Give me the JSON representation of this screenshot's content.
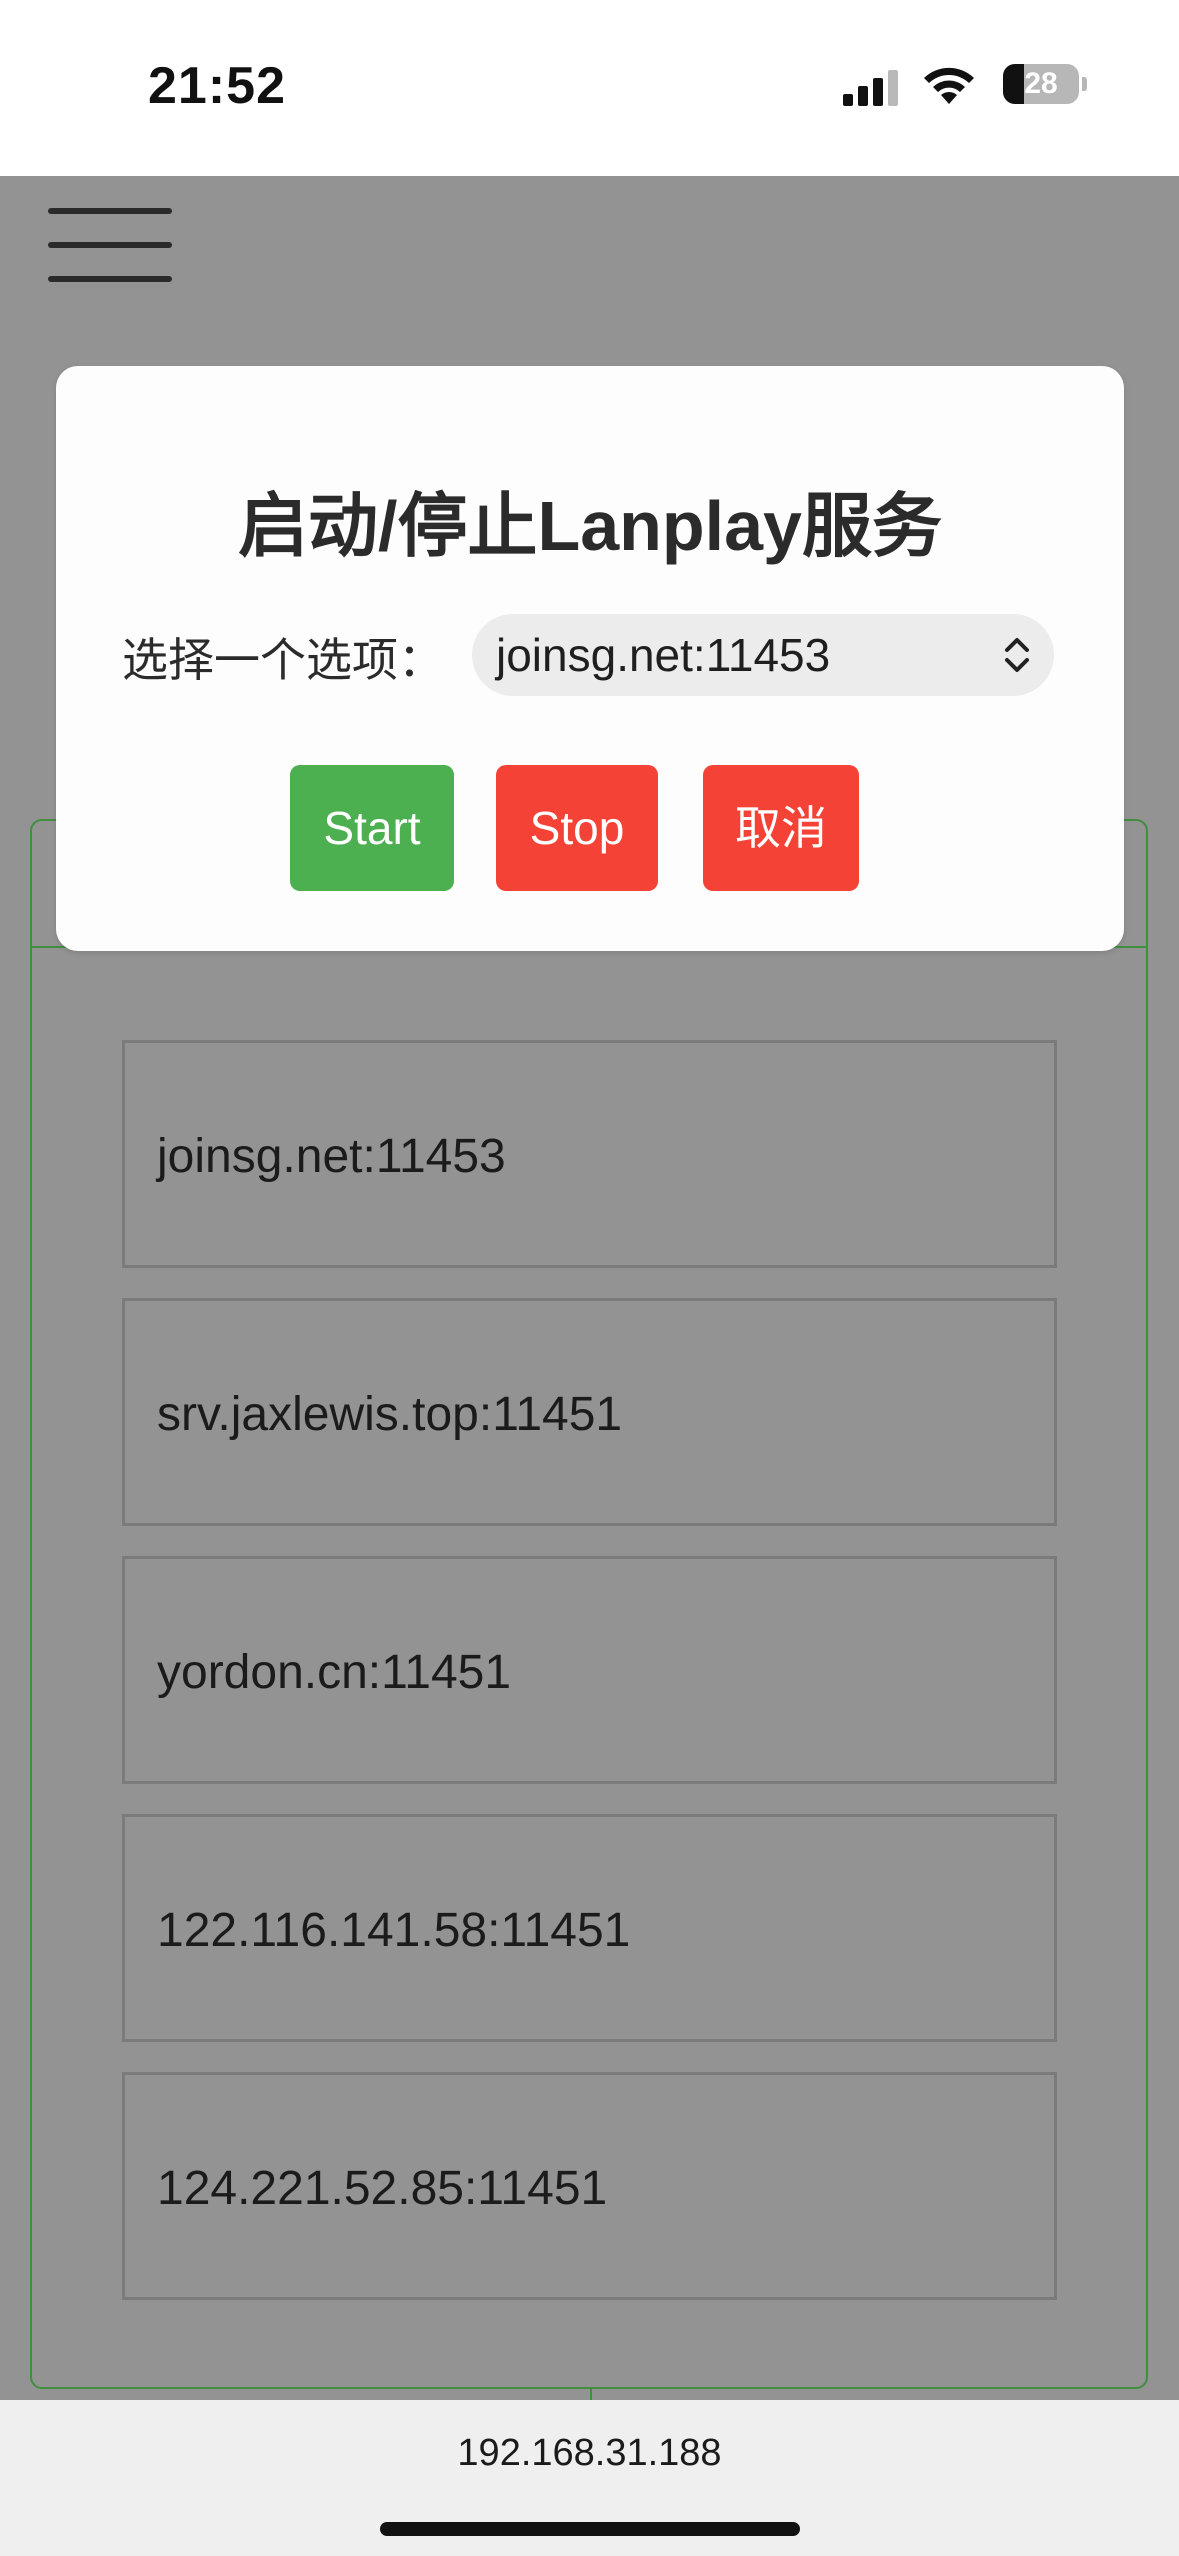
{
  "status_bar": {
    "time": "21:52",
    "battery_level": "28",
    "battery_fraction": 0.28,
    "icons": [
      "signal-icon",
      "wifi-icon",
      "battery-icon"
    ]
  },
  "page": {
    "menu_icon": "hamburger-menu-icon",
    "servers": [
      "joinsg.net:11453",
      "srv.jaxlewis.top:11451",
      "yordon.cn:11451",
      "122.116.141.58:11451",
      "124.221.52.85:11451"
    ]
  },
  "modal": {
    "title": "启动/停止Lanplay服务",
    "select_label": "选择一个选项：",
    "selected_option": "joinsg.net:11453",
    "start_label": "Start",
    "stop_label": "Stop",
    "cancel_label": "取消"
  },
  "browser": {
    "url": "192.168.31.188"
  },
  "colors": {
    "start": "#4caf50",
    "stop": "#f44336",
    "cancel": "#f44336",
    "frame_border": "#3f8f3f",
    "overlay": "#939393"
  }
}
